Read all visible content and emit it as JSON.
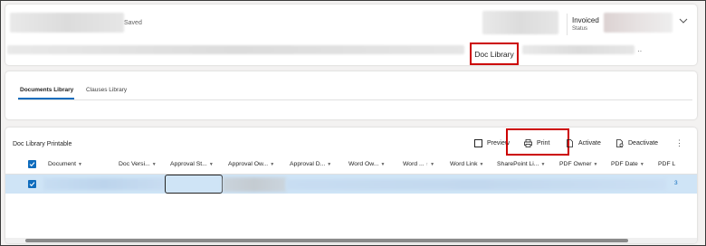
{
  "header": {
    "saved_text": "Saved",
    "status_value": "Invoiced",
    "status_label": "Status",
    "doc_library_label": "Doc Library",
    "more": "··"
  },
  "tabs": [
    {
      "label": "Documents Library",
      "active": true
    },
    {
      "label": "Clauses Library",
      "active": false
    }
  ],
  "grid": {
    "title": "Doc Library Printable",
    "commands": {
      "preview": "Preview",
      "print": "Print",
      "activate": "Activate",
      "deactivate": "Deactivate",
      "more": "⋮"
    },
    "columns": [
      "Document",
      "Doc Versi...",
      "Approval St...",
      "Approval Ow...",
      "Approval D...",
      "Word Ow...",
      "Word ...",
      "Word Link",
      "SharePoint Li...",
      "PDF Owner",
      "PDF Date",
      "PDF L"
    ],
    "row_trail": "3"
  },
  "colors": {
    "accent": "#0f6cbd",
    "highlight": "#cc0000",
    "selected_row": "#cfe4f6"
  }
}
